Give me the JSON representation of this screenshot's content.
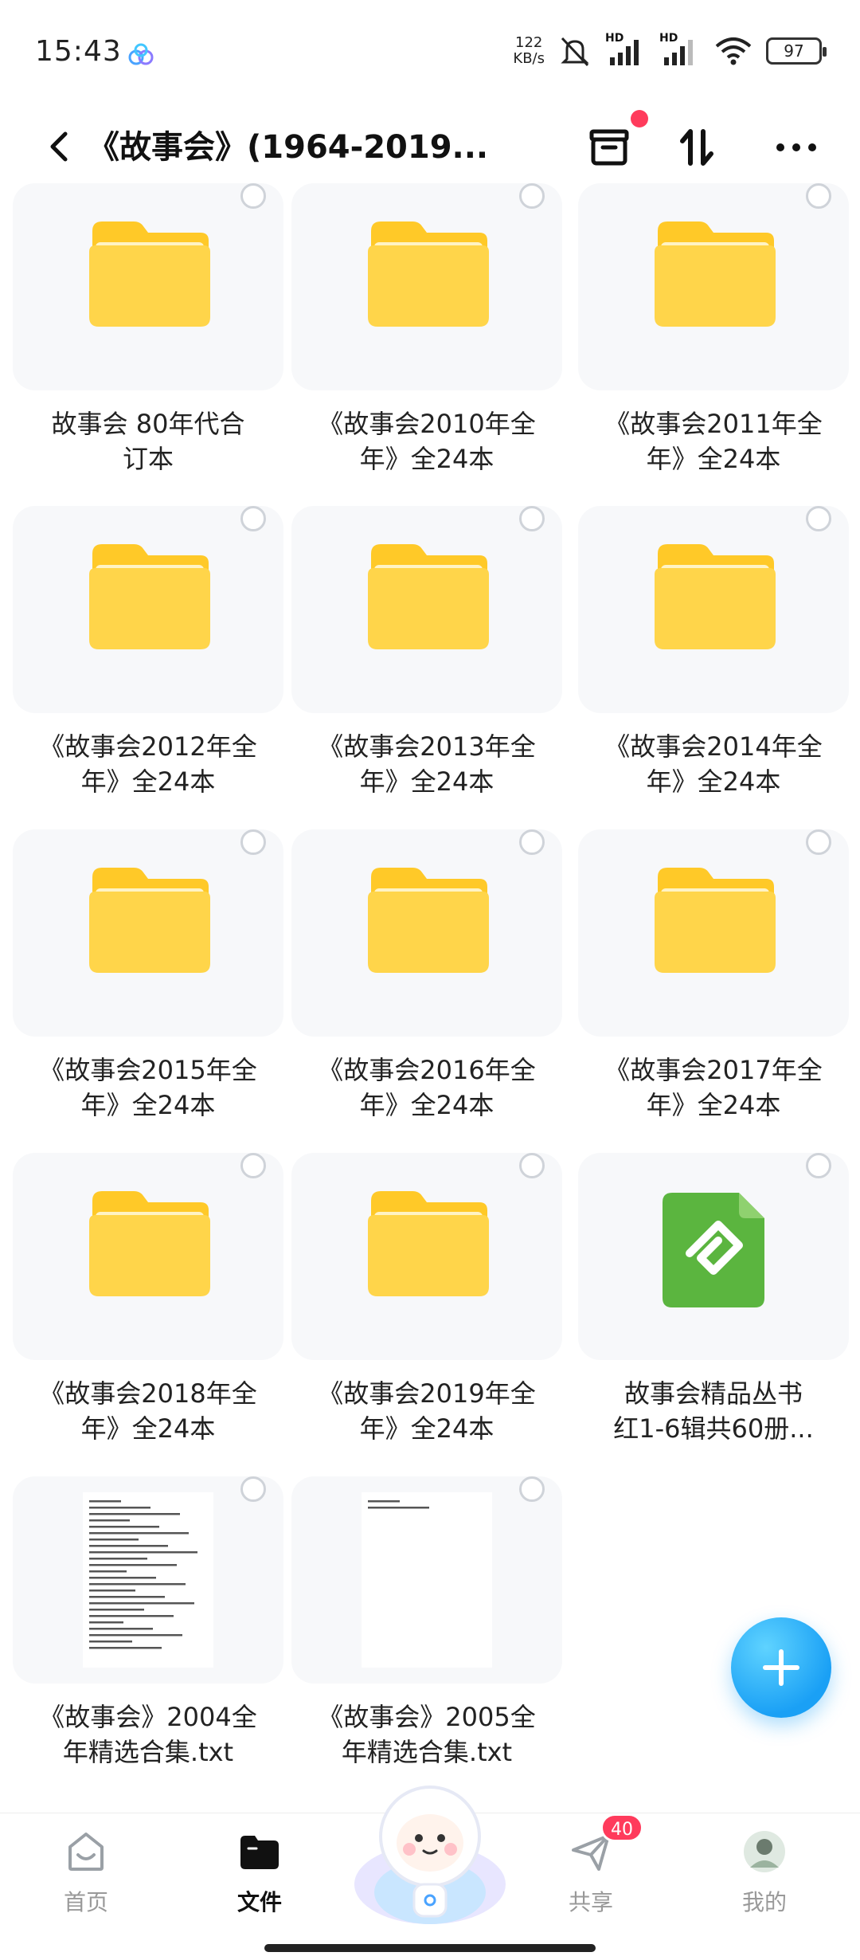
{
  "status": {
    "time": "15:43",
    "net_speed_value": "122",
    "net_speed_unit": "KB/s",
    "battery": "97",
    "hd1": "HD",
    "hd2": "HD"
  },
  "header": {
    "title": "《故事会》(1964-2019..."
  },
  "items": [
    {
      "label": "故事会 80年代合\n订本",
      "type": "folder"
    },
    {
      "label": "《故事会2010年全\n年》全24本",
      "type": "folder"
    },
    {
      "label": "《故事会2011年全\n年》全24本",
      "type": "folder"
    },
    {
      "label": "《故事会2012年全\n年》全24本",
      "type": "folder"
    },
    {
      "label": "《故事会2013年全\n年》全24本",
      "type": "folder"
    },
    {
      "label": "《故事会2014年全\n年》全24本",
      "type": "folder"
    },
    {
      "label": "《故事会2015年全\n年》全24本",
      "type": "folder"
    },
    {
      "label": "《故事会2016年全\n年》全24本",
      "type": "folder"
    },
    {
      "label": "《故事会2017年全\n年》全24本",
      "type": "folder"
    },
    {
      "label": "《故事会2018年全\n年》全24本",
      "type": "folder"
    },
    {
      "label": "《故事会2019年全\n年》全24本",
      "type": "folder"
    },
    {
      "label": "故事会精品丛书\n红1-6辑共60册...",
      "type": "epub"
    },
    {
      "label": "《故事会》2004全\n年精选合集.txt",
      "type": "txt"
    },
    {
      "label": "《故事会》2005全\n年精选合集.txt",
      "type": "txt"
    }
  ],
  "bottom_nav": [
    {
      "label": "首页",
      "icon": "home-icon",
      "active": false
    },
    {
      "label": "文件",
      "icon": "folder-icon",
      "active": true
    },
    {
      "label": "共享",
      "icon": "send-icon",
      "active": false,
      "badge": "40"
    },
    {
      "label": "我的",
      "icon": "avatar-icon",
      "active": false
    }
  ],
  "colors": {
    "folder_top": "#ffd54a",
    "folder_body": "#ffc928",
    "accent": "#1aa0f5",
    "badge": "#ff3b5c",
    "epub_green": "#5bb53f"
  }
}
